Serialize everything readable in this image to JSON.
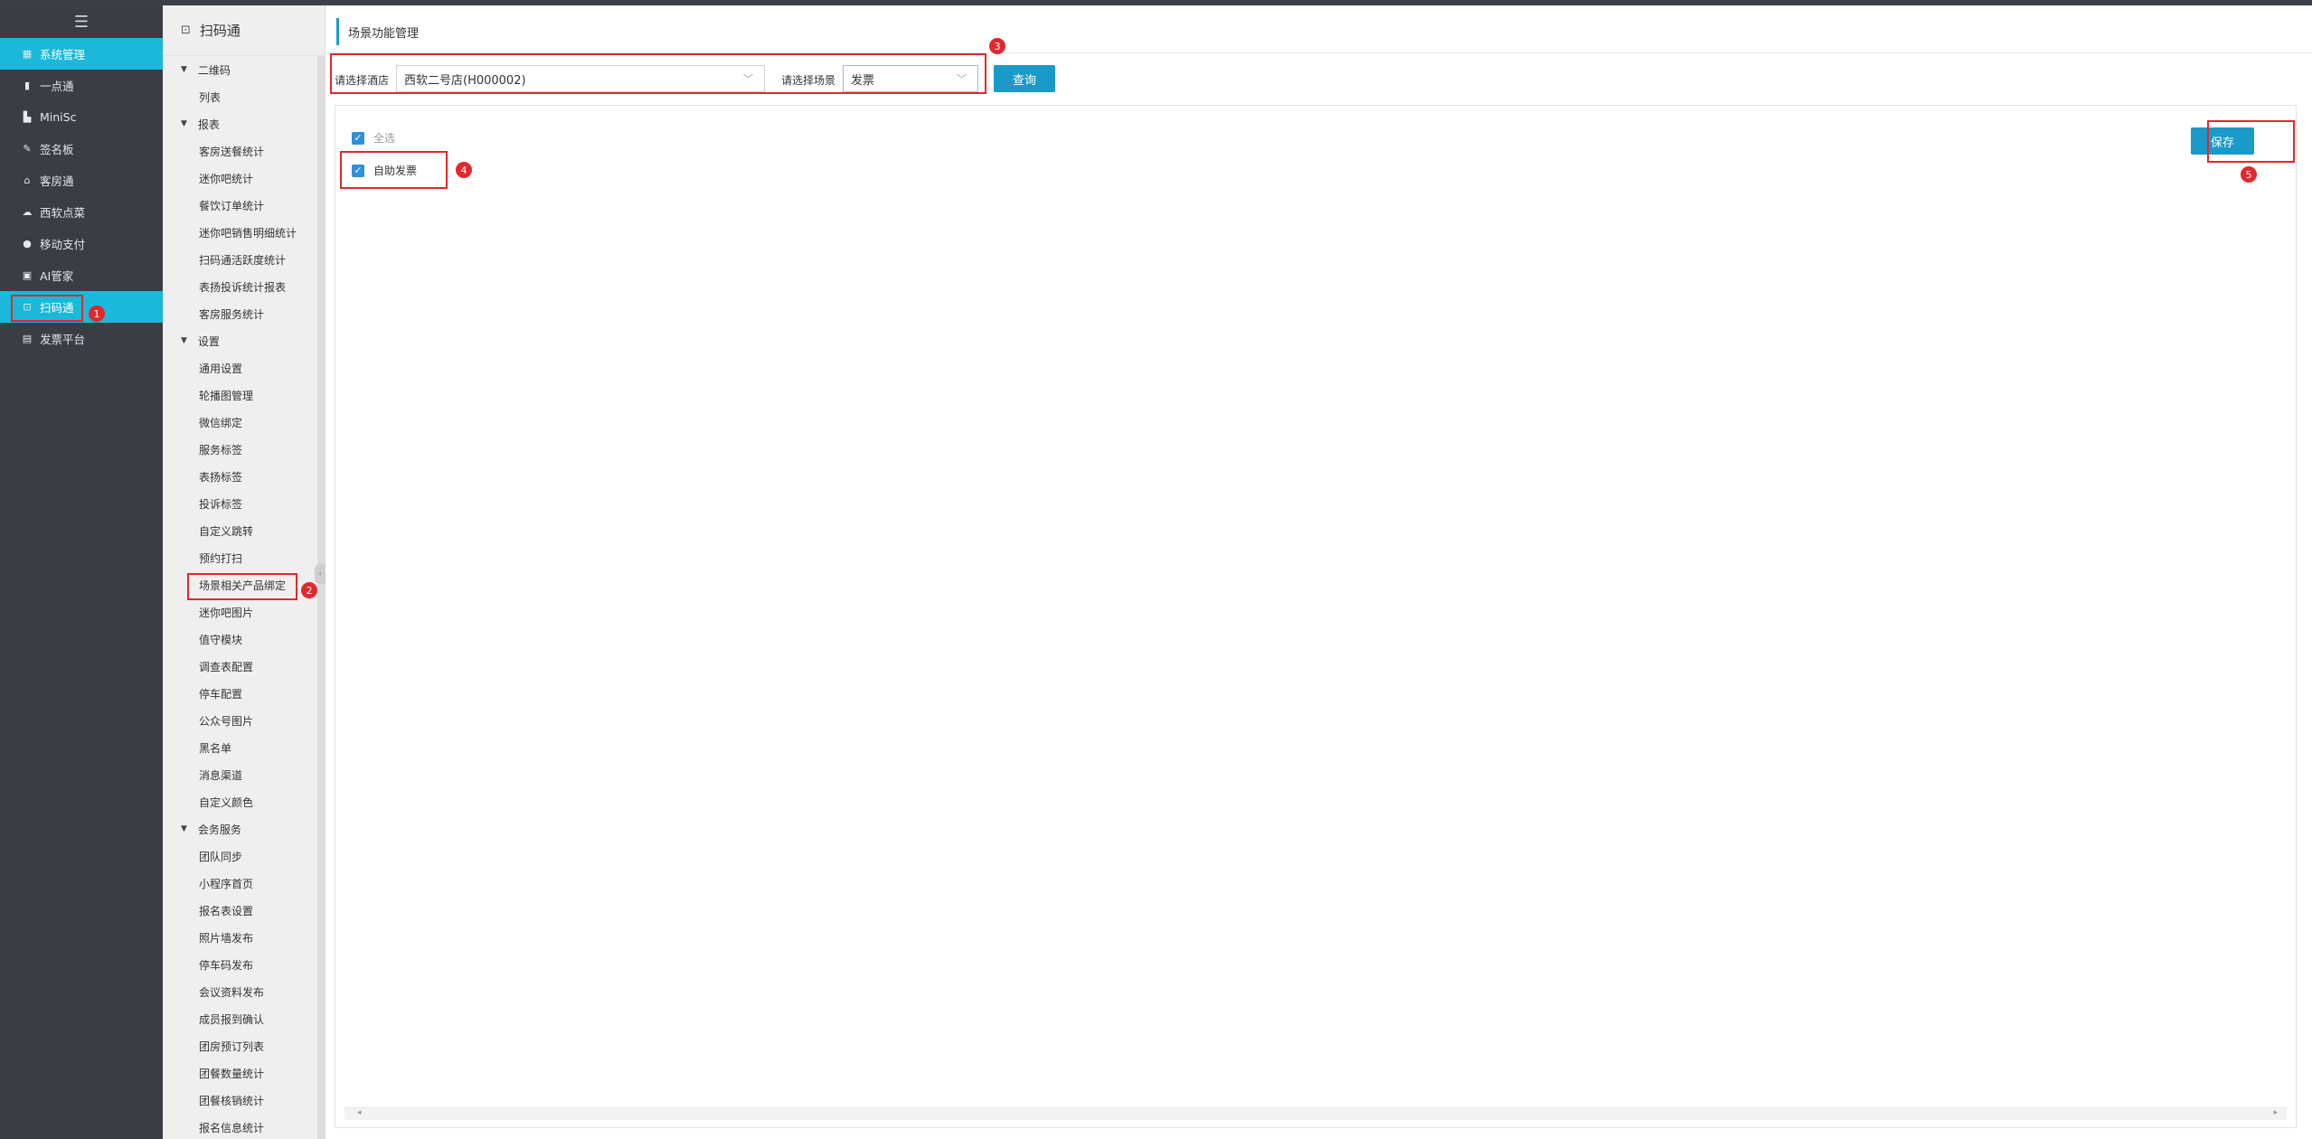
{
  "sidebar": {
    "toggle_icon": "menu-icon",
    "items": [
      {
        "label": "系统管理",
        "icon": "grid-icon",
        "active": true
      },
      {
        "label": "一点通",
        "icon": "bar-chart-icon"
      },
      {
        "label": "MiniSc",
        "icon": "doc-icon"
      },
      {
        "label": "签名板",
        "icon": "pen-icon"
      },
      {
        "label": "客房通",
        "icon": "home-icon"
      },
      {
        "label": "西软点菜",
        "icon": "cloud-icon"
      },
      {
        "label": "移动支付",
        "icon": "coin-icon"
      },
      {
        "label": "AI管家",
        "icon": "bot-icon"
      },
      {
        "label": "扫码通",
        "icon": "scan-icon",
        "active": true
      },
      {
        "label": "发票平台",
        "icon": "invoice-icon"
      }
    ]
  },
  "submenu": {
    "title": "扫码通",
    "groups": [
      {
        "label": "二维码",
        "items": [
          "列表"
        ]
      },
      {
        "label": "报表",
        "items": [
          "客房送餐统计",
          "迷你吧统计",
          "餐饮订单统计",
          "迷你吧销售明细统计",
          "扫码通活跃度统计",
          "表扬投诉统计报表",
          "客房服务统计"
        ]
      },
      {
        "label": "设置",
        "items": [
          "通用设置",
          "轮播图管理",
          "微信绑定",
          "服务标签",
          "表扬标签",
          "投诉标签",
          "自定义跳转",
          "预约打扫",
          "场景相关产品绑定",
          "迷你吧图片",
          "值守模块",
          "调查表配置",
          "停车配置",
          "公众号图片",
          "黑名单",
          "消息渠道",
          "自定义颜色"
        ]
      },
      {
        "label": "会务服务",
        "items": [
          "团队同步",
          "小程序首页",
          "报名表设置",
          "照片墙发布",
          "停车码发布",
          "会议资料发布",
          "成员报到确认",
          "团房预订列表",
          "团餐数量统计",
          "团餐核销统计",
          "报名信息统计"
        ]
      }
    ]
  },
  "main": {
    "title": "场景功能管理",
    "hotel_label": "请选择酒店",
    "hotel_value": "西软二号店(H000002)",
    "scene_label": "请选择场景",
    "scene_value": "发票",
    "query_label": "查询",
    "select_all_label": "全选",
    "option_label": "自助发票",
    "save_label": "保存"
  },
  "annotations": [
    "1",
    "2",
    "3",
    "4",
    "5"
  ],
  "colors": {
    "accent": "#1a9ac9",
    "active_nav": "#1bb8d9",
    "sidebar_bg": "#3a3d44",
    "annotation_red": "#e0282e"
  }
}
